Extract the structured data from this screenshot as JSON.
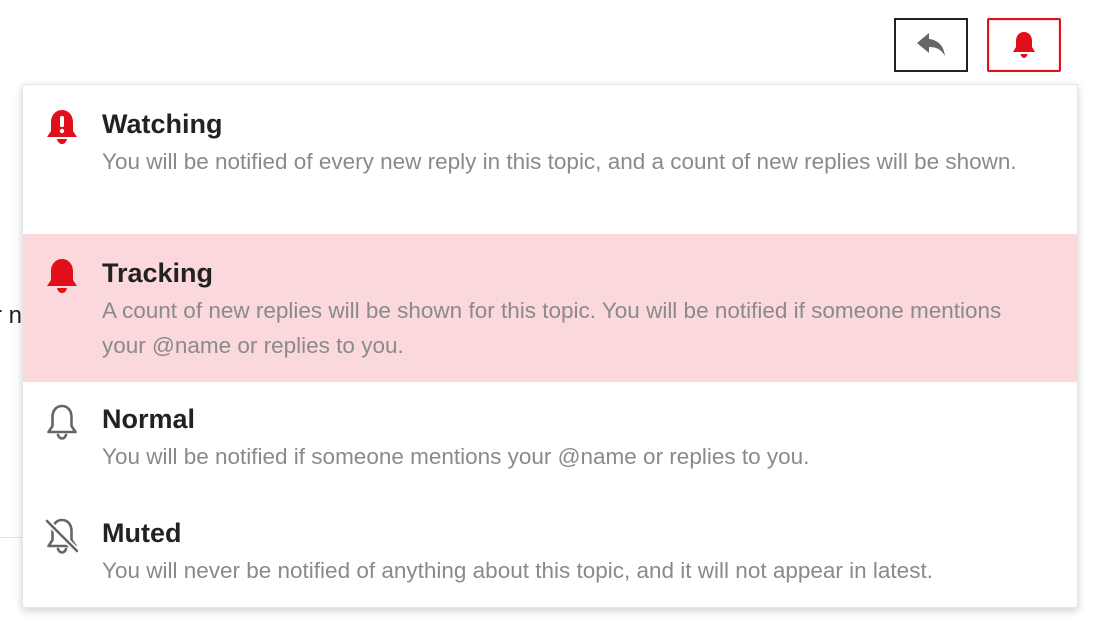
{
  "background": {
    "peek_text": "r n"
  },
  "header": {
    "reply_button": {
      "icon": "reply-icon",
      "color": "#666666"
    },
    "notifications_button": {
      "icon": "bell-icon",
      "color": "#e10f1a",
      "state": "active"
    }
  },
  "menu": {
    "items": [
      {
        "title": "Watching",
        "description": "You will be notified of every new reply in this topic, and a count of new replies will be shown.",
        "icon": "bell-exclamation-icon",
        "icon_color": "#e10f1a",
        "selected": false
      },
      {
        "title": "Tracking",
        "description": "A count of new replies will be shown for this topic. You will be notified if someone mentions your @name or replies to you.",
        "icon": "bell-filled-icon",
        "icon_color": "#e10f1a",
        "selected": true
      },
      {
        "title": "Normal",
        "description": "You will be notified if someone mentions your @name or replies to you.",
        "icon": "bell-outline-icon",
        "icon_color": "#666666",
        "selected": false
      },
      {
        "title": "Muted",
        "description": "You will never be notified of anything about this topic, and it will not appear in latest.",
        "icon": "bell-slash-icon",
        "icon_color": "#666666",
        "selected": false
      }
    ],
    "selected_background": "#fbd8db"
  }
}
